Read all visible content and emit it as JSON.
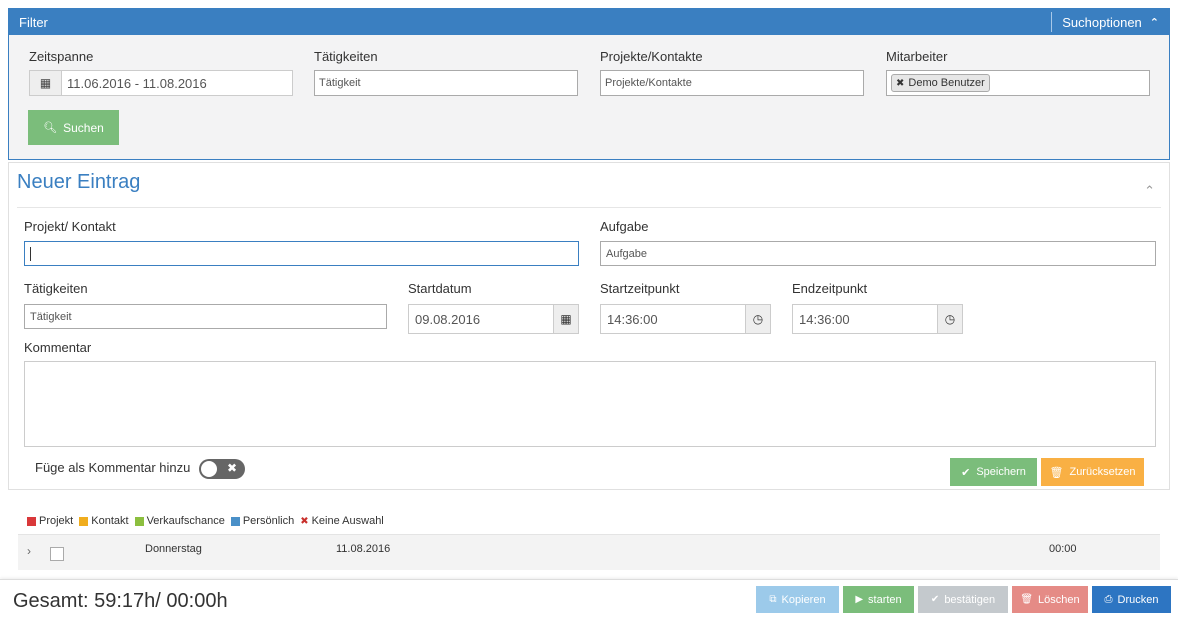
{
  "filter": {
    "header": "Filter",
    "options_label": "Suchoptionen",
    "zeitspanne": {
      "label": "Zeitspanne",
      "value": "11.06.2016 - 11.08.2016"
    },
    "taetigkeiten": {
      "label": "Tätigkeiten",
      "placeholder": "Tätigkeit"
    },
    "projekte": {
      "label": "Projekte/Kontakte",
      "placeholder": "Projekte/Kontakte"
    },
    "mitarbeiter": {
      "label": "Mitarbeiter",
      "tag": "Demo Benutzer"
    },
    "search_button": "Suchen"
  },
  "entry": {
    "title": "Neuer Eintrag",
    "projekt": {
      "label": "Projekt/ Kontakt",
      "value": ""
    },
    "aufgabe": {
      "label": "Aufgabe",
      "placeholder": "Aufgabe"
    },
    "taetigkeiten": {
      "label": "Tätigkeiten",
      "placeholder": "Tätigkeit"
    },
    "startdatum": {
      "label": "Startdatum",
      "value": "09.08.2016"
    },
    "startzeit": {
      "label": "Startzeitpunkt",
      "value": "14:36:00"
    },
    "endzeit": {
      "label": "Endzeitpunkt",
      "value": "14:36:00"
    },
    "kommentar": {
      "label": "Kommentar",
      "value": ""
    },
    "add_comment_label": "Füge als Kommentar hinzu",
    "save_button": "Speichern",
    "reset_button": "Zurücksetzen"
  },
  "legend": [
    {
      "label": "Projekt",
      "color": "#d9383a"
    },
    {
      "label": "Kontakt",
      "color": "#f0ad1e"
    },
    {
      "label": "Verkaufschance",
      "color": "#8cbf3f"
    },
    {
      "label": "Persönlich",
      "color": "#4a90c8"
    },
    {
      "label": "Keine Auswahl",
      "color": "#c9302c"
    }
  ],
  "rows": [
    {
      "day": "Donnerstag",
      "date": "11.08.2016",
      "time": "00:00"
    }
  ],
  "footer": {
    "total": "Gesamt: 59:17h/ 00:00h",
    "buttons": {
      "copy": "Kopieren",
      "start": "starten",
      "confirm": "bestätigen",
      "delete": "Löschen",
      "print": "Drucken"
    }
  },
  "colors": {
    "primary": "#3a7fc1",
    "success": "#7bbd7b",
    "warning": "#f9b044",
    "danger": "#e58b86",
    "info": "#9ccaea",
    "disabled": "#c4c9cd",
    "print": "#2d75c2"
  }
}
